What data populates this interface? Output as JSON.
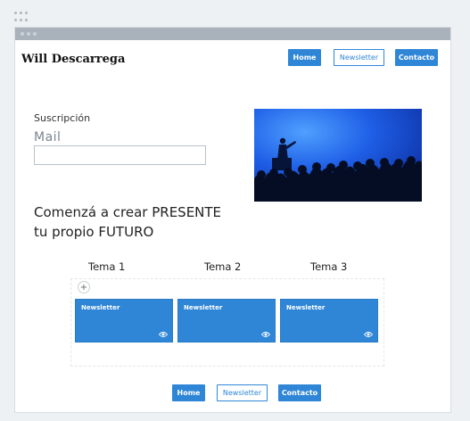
{
  "brand": "Will Descarrega",
  "nav": {
    "home": "Home",
    "newsletter": "Newsletter",
    "contacto": "Contacto"
  },
  "subscription": {
    "label": "Suscripción",
    "mail_label": "Mail",
    "mail_value": ""
  },
  "hero": {
    "image": "audience-speaker-stage-photo"
  },
  "headline": {
    "line1": "Comenzá a crear PRESENTE",
    "line2": "tu propio FUTURO"
  },
  "temas": [
    "Tema 1",
    "Tema 2",
    "Tema 3"
  ],
  "cards": [
    {
      "title": "Newsletter",
      "icon": "eye-icon"
    },
    {
      "title": "Newsletter",
      "icon": "eye-icon"
    },
    {
      "title": "Newsletter",
      "icon": "eye-icon"
    }
  ],
  "add_symbol": "+",
  "footer_nav": {
    "home": "Home",
    "newsletter": "Newsletter",
    "contacto": "Contacto"
  },
  "colors": {
    "accent": "#2f86d6",
    "titlebar": "#a9b2bb",
    "background": "#eef1f4"
  }
}
